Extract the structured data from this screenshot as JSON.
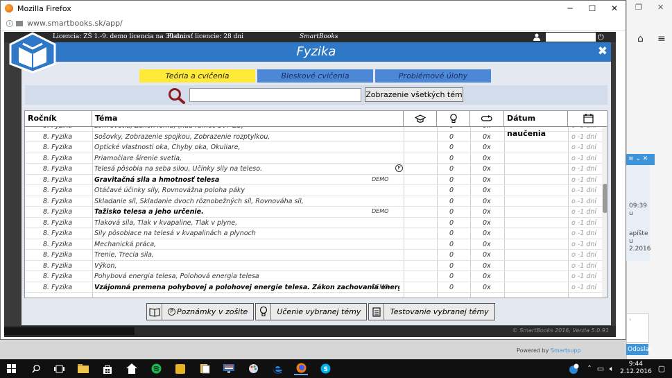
{
  "browser": {
    "title": "Mozilla Firefox",
    "url": "www.smartbooks.sk/app/",
    "controls": {
      "minimize": "─",
      "maximize": "☐",
      "close": "✕"
    }
  },
  "topstrip": {
    "license": "Licencia: ZŠ 1.-9. demo licencia na 30 dni",
    "validity": "Platnosť licencie: 28 dni",
    "brand": "SmartBooks"
  },
  "header": {
    "title": "Fyzika",
    "close": "✖"
  },
  "tabs": [
    {
      "label": "Teória a cvičenia",
      "active": true
    },
    {
      "label": "Bleskové cvičenia",
      "active": false
    },
    {
      "label": "Problémové úlohy",
      "active": false
    }
  ],
  "search": {
    "value": "",
    "button": "Zobrazenie všetkých tém"
  },
  "columns": {
    "rocnik": "Ročník",
    "tema": "Téma",
    "datum": "Dátum naučenia"
  },
  "rows": [
    {
      "grade": "8. Fyzika",
      "topic": "Lom svetla, Zákon lomu, (nad rámec ŠVP ZŠ)",
      "demo": "",
      "pmark": "",
      "score": "0",
      "count": "0x",
      "days": "o -1 dní",
      "bold": false
    },
    {
      "grade": "8. Fyzika",
      "topic": "Šošovky, Zobrazenie spojkou, Zobrazenie rozptylkou,",
      "demo": "",
      "pmark": "",
      "score": "0",
      "count": "0x",
      "days": "o -1 dní",
      "bold": false
    },
    {
      "grade": "8. Fyzika",
      "topic": "Optické vlastnosti oka, Chyby oka, Okuliare,",
      "demo": "",
      "pmark": "",
      "score": "0",
      "count": "0x",
      "days": "o -1 dní",
      "bold": false
    },
    {
      "grade": "8. Fyzika",
      "topic": "Priamočiare šírenie svetla,",
      "demo": "",
      "pmark": "",
      "score": "0",
      "count": "0x",
      "days": "o -1 dní",
      "bold": false
    },
    {
      "grade": "8. Fyzika",
      "topic": "Telesá pôsobia na seba silou, Účinky sily na teleso.",
      "demo": "",
      "pmark": "P",
      "score": "0",
      "count": "0x",
      "days": "o -1 dní",
      "bold": false
    },
    {
      "grade": "8. Fyzika",
      "topic": "Gravitačná sila a hmotnosť telesa",
      "demo": "DEMO",
      "pmark": "",
      "score": "0",
      "count": "0x",
      "days": "o -1 dní",
      "bold": true
    },
    {
      "grade": "8. Fyzika",
      "topic": "Otáčavé účinky sily, Rovnovážna poloha páky",
      "demo": "",
      "pmark": "",
      "score": "0",
      "count": "0x",
      "days": "o -1 dní",
      "bold": false
    },
    {
      "grade": "8. Fyzika",
      "topic": "Skladanie síl, Skladanie dvoch rôznobežných síl, Rovnováha síl,",
      "demo": "",
      "pmark": "",
      "score": "0",
      "count": "0x",
      "days": "o -1 dní",
      "bold": false
    },
    {
      "grade": "8. Fyzika",
      "topic": "Ťažisko telesa a jeho určenie.",
      "demo": "DEMO",
      "pmark": "",
      "score": "0",
      "count": "0x",
      "days": "o -1 dní",
      "bold": true
    },
    {
      "grade": "8. Fyzika",
      "topic": "Tlaková sila, Tlak v kvapaline, Tlak v plyne,",
      "demo": "",
      "pmark": "",
      "score": "0",
      "count": "0x",
      "days": "o -1 dní",
      "bold": false
    },
    {
      "grade": "8. Fyzika",
      "topic": "Sily pôsobiace na telesá v kvapalinách a plynoch",
      "demo": "",
      "pmark": "",
      "score": "0",
      "count": "0x",
      "days": "o -1 dní",
      "bold": false
    },
    {
      "grade": "8. Fyzika",
      "topic": "Mechanická práca,",
      "demo": "",
      "pmark": "",
      "score": "0",
      "count": "0x",
      "days": "o -1 dní",
      "bold": false
    },
    {
      "grade": "8. Fyzika",
      "topic": "Trenie, Trecia sila,",
      "demo": "",
      "pmark": "",
      "score": "0",
      "count": "0x",
      "days": "o -1 dní",
      "bold": false
    },
    {
      "grade": "8. Fyzika",
      "topic": "Výkon,",
      "demo": "",
      "pmark": "",
      "score": "0",
      "count": "0x",
      "days": "o -1 dní",
      "bold": false
    },
    {
      "grade": "8. Fyzika",
      "topic": "Pohybová energia telesa, Polohová energia telesa",
      "demo": "",
      "pmark": "",
      "score": "0",
      "count": "0x",
      "days": "o -1 dní",
      "bold": false
    },
    {
      "grade": "8. Fyzika",
      "topic": "Vzájomná premena pohybovej a polohovej energie telesa. Zákon zachovania energie",
      "demo": "DEMO",
      "pmark": "",
      "score": "0",
      "count": "0x",
      "days": "o -1 dní",
      "bold": true
    }
  ],
  "bottom_buttons": [
    "Poznámky v zošite",
    "Učenie vybranej témy",
    "Testovanie vybranej témy"
  ],
  "footer": {
    "copyright": "© SmartBooks 2016, Verzia 5.0.91"
  },
  "side": {
    "chat_time": "09:39",
    "chat_text": "u",
    "chat_text2": "apíšte",
    "chat_text3": "u",
    "chat_text4": "2.2016",
    "send": "Odoslať",
    "powered_prefix": "Powered by",
    "powered_brand": "Smartsupp"
  },
  "taskbar": {
    "time": "9:44",
    "date": "2.12.2016"
  }
}
